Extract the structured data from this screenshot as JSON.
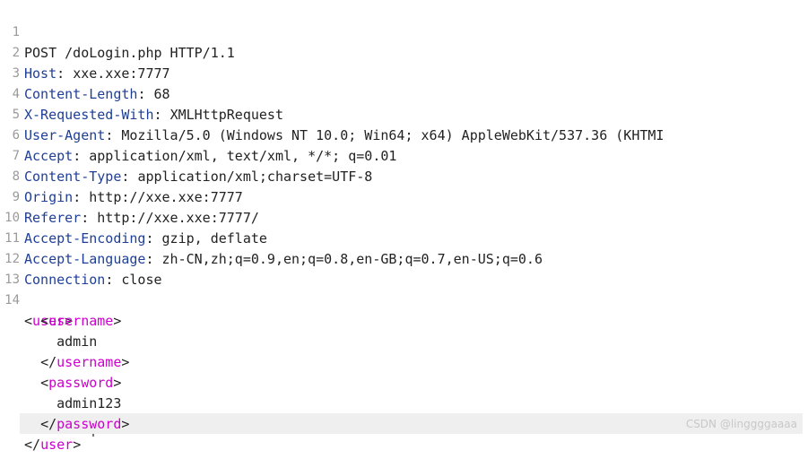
{
  "request": {
    "request_line": "POST /doLogin.php HTTP/1.1",
    "headers": [
      {
        "name": "Host",
        "value": "xxe.xxe:7777"
      },
      {
        "name": "Content-Length",
        "value": "68"
      },
      {
        "name": "X-Requested-With",
        "value": "XMLHttpRequest"
      },
      {
        "name": "User-Agent",
        "value": "Mozilla/5.0 (Windows NT 10.0; Win64; x64) AppleWebKit/537.36 (KHTMI"
      },
      {
        "name": "Accept",
        "value": "application/xml, text/xml, */*; q=0.01"
      },
      {
        "name": "Content-Type",
        "value": "application/xml;charset=UTF-8"
      },
      {
        "name": "Origin",
        "value": "http://xxe.xxe:7777"
      },
      {
        "name": "Referer",
        "value": "http://xxe.xxe:7777/"
      },
      {
        "name": "Accept-Encoding",
        "value": "gzip, deflate"
      },
      {
        "name": "Accept-Language",
        "value": "zh-CN,zh;q=0.9,en;q=0.8,en-GB;q=0.7,en-US;q=0.6"
      },
      {
        "name": "Connection",
        "value": "close"
      }
    ],
    "body": {
      "user_tag": "user",
      "username_tag": "username",
      "username_value": "admin",
      "password_tag": "password",
      "password_value": "admin123"
    }
  },
  "line_numbers": [
    "1",
    "2",
    "3",
    "4",
    "5",
    "6",
    "7",
    "8",
    "9",
    "10",
    "11",
    "12",
    "13",
    "14"
  ],
  "watermark": "CSDN @linggggaaaa",
  "colors": {
    "header_name": "#1f3f97",
    "xml_tag": "#cc00cc",
    "line_number": "#9a9a9a"
  }
}
